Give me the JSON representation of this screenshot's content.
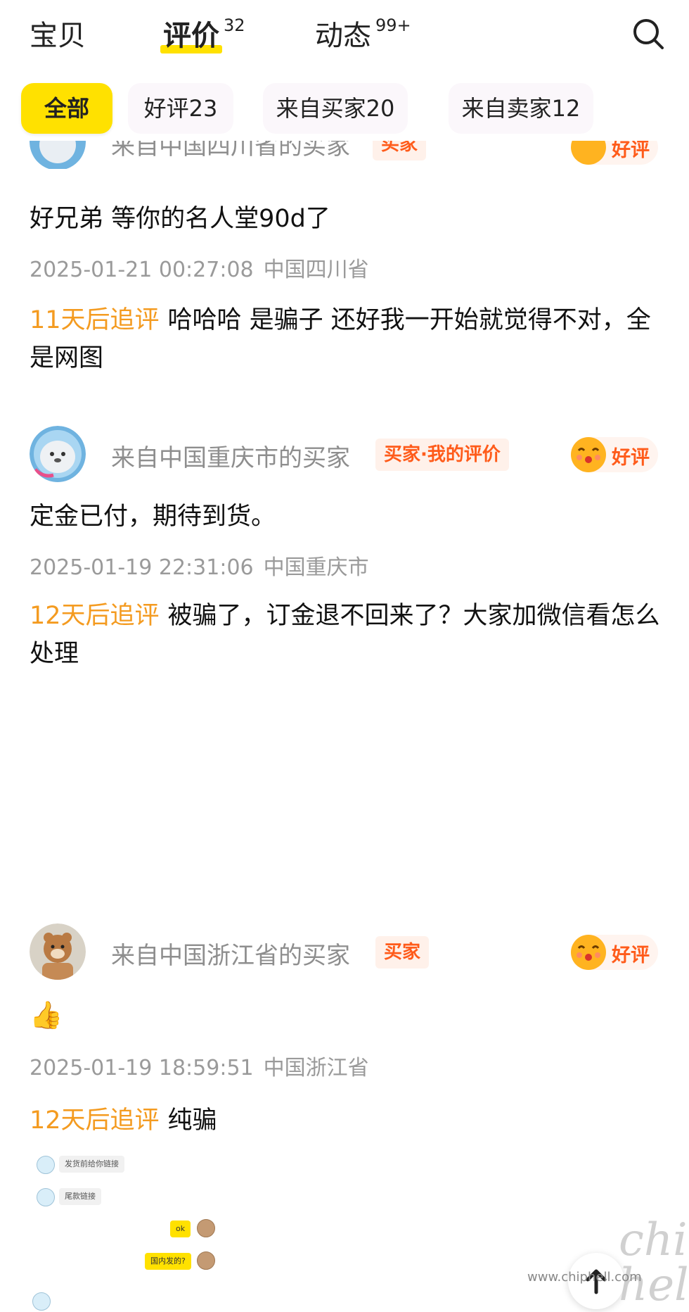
{
  "tabs": [
    {
      "label": "宝贝",
      "badge": ""
    },
    {
      "label": "评价",
      "badge": "32"
    },
    {
      "label": "动态",
      "badge": "99+"
    }
  ],
  "filters": [
    "全部",
    "好评23",
    "来自买家20",
    "来自卖家12"
  ],
  "reviews": [
    {
      "buyer": "来自中国四川省的买家",
      "badge": "买家",
      "rating": "好评",
      "content": "好兄弟 等你的名人堂90d了",
      "date": "2025-01-21 00:27:08",
      "location": "中国四川省",
      "followup_label": "11天后追评",
      "followup_text": "哈哈哈 是骗子 还好我一开始就觉得不对，全是网图"
    },
    {
      "buyer": "来自中国重庆市的买家",
      "badge": "买家·我的评价",
      "rating": "好评",
      "content": "定金已付，期待到货。",
      "date": "2025-01-19 22:31:06",
      "location": "中国重庆市",
      "followup_label": "12天后追评",
      "followup_text": "被骗了，订金退不回来了？大家加微信看怎么处理"
    },
    {
      "buyer": "来自中国浙江省的买家",
      "badge": "买家",
      "rating": "好评",
      "content": "👍",
      "date": "2025-01-19 18:59:51",
      "location": "中国浙江省",
      "followup_label": "12天后追评",
      "followup_text": "纯骗"
    }
  ],
  "chat_image": {
    "msg1": "发货前给你链接",
    "msg2": "尾款链接",
    "msg3": "ok",
    "msg4": "国内发的?"
  },
  "watermark": {
    "logo": "chip hell",
    "url": "www.chiphell.com"
  },
  "colors": {
    "accent_yellow": "#ffe100",
    "followup_orange": "#f49b20",
    "badge_orange": "#ff5b1a",
    "meta_gray": "#9a9a9a"
  },
  "icons": {
    "search": "search-icon",
    "rating": "smile-face-icon",
    "scroll_top": "arrow-up-icon"
  }
}
